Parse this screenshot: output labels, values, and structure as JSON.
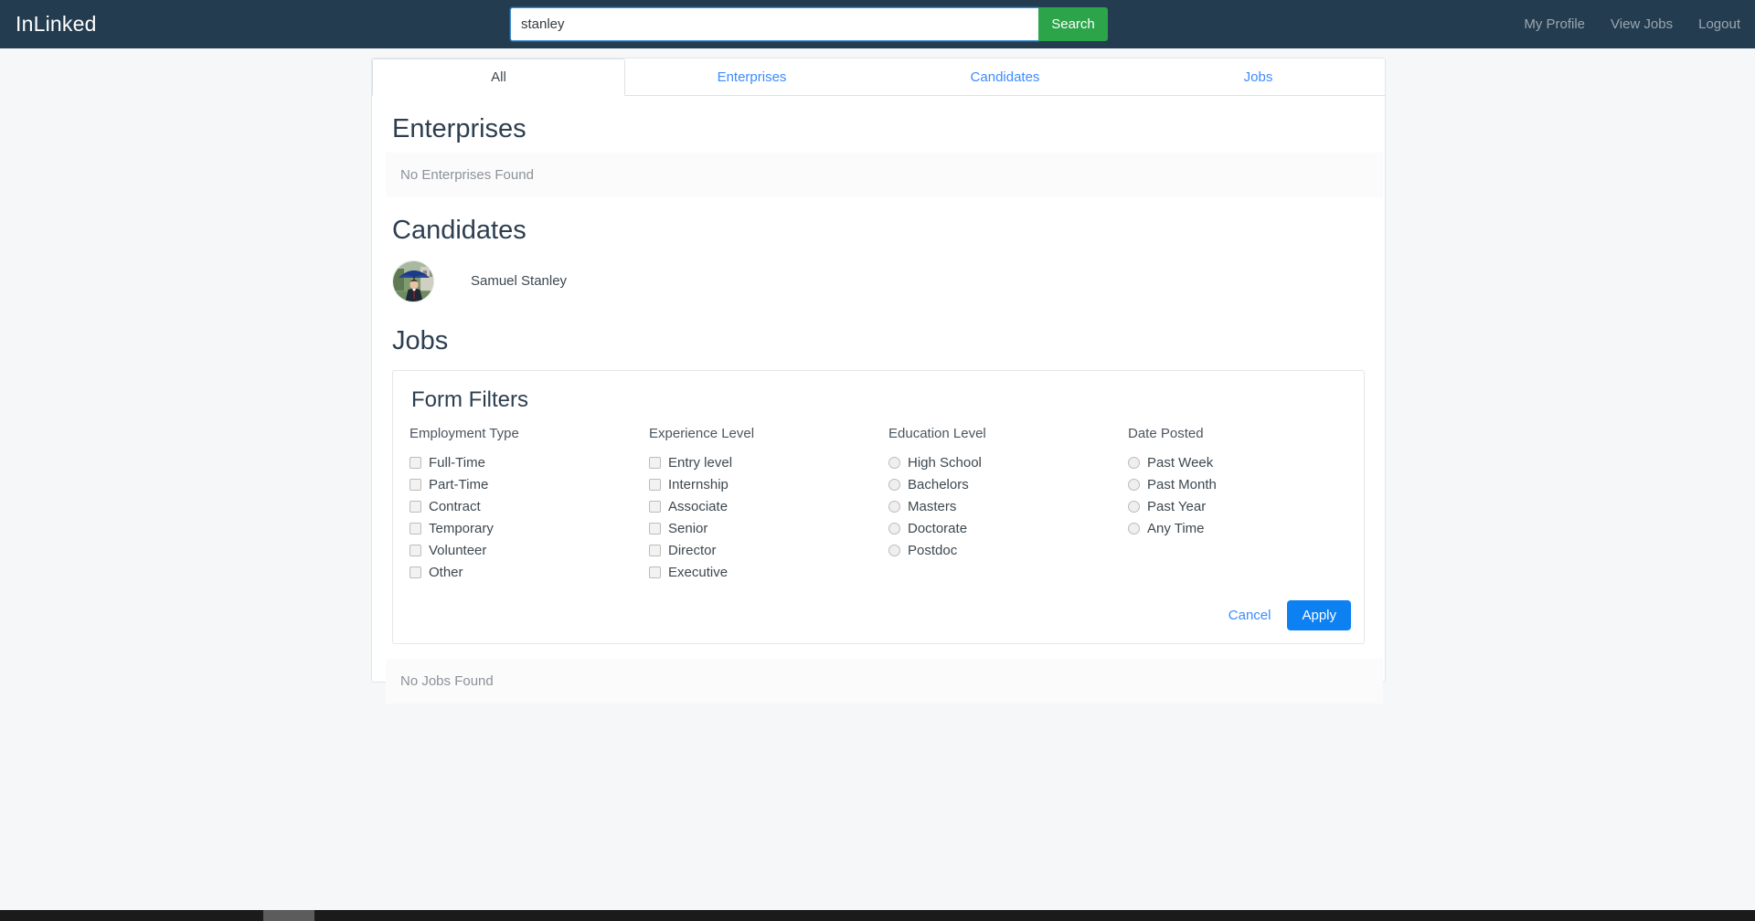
{
  "navbar": {
    "brand": "InLinked",
    "search": {
      "value": "stanley",
      "placeholder": "",
      "button_label": "Search"
    },
    "links": [
      {
        "label": "My Profile"
      },
      {
        "label": "View Jobs"
      },
      {
        "label": "Logout"
      }
    ]
  },
  "tabs": [
    {
      "label": "All",
      "active": true
    },
    {
      "label": "Enterprises",
      "active": false
    },
    {
      "label": "Candidates",
      "active": false
    },
    {
      "label": "Jobs",
      "active": false
    }
  ],
  "sections": {
    "enterprises": {
      "heading": "Enterprises",
      "empty_text": "No Enterprises Found"
    },
    "candidates": {
      "heading": "Candidates",
      "results": [
        {
          "name": "Samuel Stanley"
        }
      ]
    },
    "jobs": {
      "heading": "Jobs",
      "empty_text": "No Jobs Found"
    }
  },
  "filters": {
    "title": "Form Filters",
    "columns": [
      {
        "label": "Employment Type",
        "control": "checkbox",
        "options": [
          "Full-Time",
          "Part-Time",
          "Contract",
          "Temporary",
          "Volunteer",
          "Other"
        ]
      },
      {
        "label": "Experience Level",
        "control": "checkbox",
        "options": [
          "Entry level",
          "Internship",
          "Associate",
          "Senior",
          "Director",
          "Executive"
        ]
      },
      {
        "label": "Education Level",
        "control": "radio",
        "options": [
          "High School",
          "Bachelors",
          "Masters",
          "Doctorate",
          "Postdoc"
        ]
      },
      {
        "label": "Date Posted",
        "control": "radio",
        "options": [
          "Past Week",
          "Past Month",
          "Past Year",
          "Any Time"
        ]
      }
    ],
    "cancel_label": "Cancel",
    "apply_label": "Apply"
  },
  "colors": {
    "navbar_bg": "#233c50",
    "search_button": "#2ca44a",
    "link_blue": "#3d8bfd",
    "primary_button": "#0d80f2",
    "page_bg": "#f5f7f9",
    "heading": "#2d3e50"
  }
}
